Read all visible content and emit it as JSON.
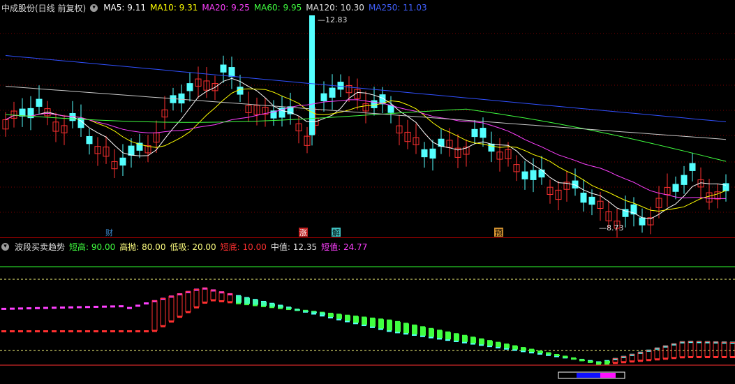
{
  "main": {
    "title": "中成股份(日线 前复权)",
    "ma": [
      {
        "label": "MA5:",
        "value": "9.11",
        "color": "#ffffff"
      },
      {
        "label": "MA10:",
        "value": "9.31",
        "color": "#ffff00"
      },
      {
        "label": "MA20:",
        "value": "9.25",
        "color": "#ff40ff"
      },
      {
        "label": "MA60:",
        "value": "9.95",
        "color": "#40ff40"
      },
      {
        "label": "MA120:",
        "value": "10.30",
        "color": "#e0e0e0"
      },
      {
        "label": "MA250:",
        "value": "11.03",
        "color": "#4060ff"
      }
    ],
    "high_label": "12.83",
    "low_label": "8.73",
    "events": [
      {
        "text": "财",
        "color": "#3b8bd0",
        "bg": "#000"
      },
      {
        "text": "涨",
        "color": "#ffffff",
        "bg": "#c02020"
      },
      {
        "text": "解",
        "color": "#000000",
        "bg": "#40c0c0"
      },
      {
        "text": "预",
        "color": "#000000",
        "bg": "#d09030"
      }
    ]
  },
  "indicator": {
    "title": "波段买卖趋势",
    "params": [
      {
        "label": "短高:",
        "value": "90.00",
        "color": "#40ff40"
      },
      {
        "label": "高抛:",
        "value": "80.00",
        "color": "#ffff80"
      },
      {
        "label": "低吸:",
        "value": "20.00",
        "color": "#ffff80"
      },
      {
        "label": "短底:",
        "value": "10.00",
        "color": "#ff3030"
      },
      {
        "label": "中值:",
        "value": "12.35",
        "color": "#e0e0e0"
      },
      {
        "label": "短值:",
        "value": "24.77",
        "color": "#ff40ff"
      }
    ]
  },
  "colors": {
    "up": "#ff3030",
    "down": "#54ffff",
    "grid": "#800000"
  }
}
